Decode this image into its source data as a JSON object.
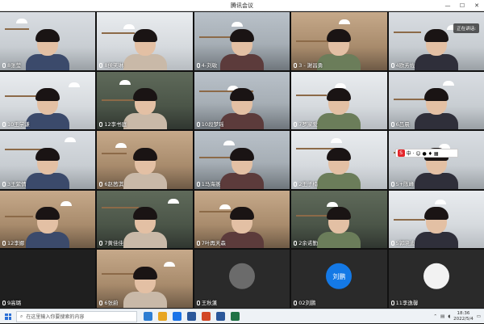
{
  "window": {
    "title": "腾讯会议",
    "minimize": "—",
    "maximize": "☐",
    "close": "✕"
  },
  "speaking": "正在讲话:",
  "ime": {
    "logo": "S",
    "items": "中 · ☺ ● ♦ ▦"
  },
  "tiles": [
    {
      "name": "8张莹",
      "type": "cam",
      "wall": "wall-a"
    },
    {
      "name": "8侯笑琳",
      "type": "cam",
      "wall": "wall-c"
    },
    {
      "name": "4-刘敏",
      "type": "cam",
      "wall": "wall-b"
    },
    {
      "name": "3 - 謝昌勇",
      "type": "cam",
      "wall": "wall-e"
    },
    {
      "name": "4欧芳佐",
      "type": "cam",
      "wall": "wall-a"
    },
    {
      "name": "10王学谦",
      "type": "cam",
      "wall": "wall-c"
    },
    {
      "name": "12李书庭",
      "type": "cam",
      "wall": "wall-d"
    },
    {
      "name": "10段梦瑶",
      "type": "cam",
      "wall": "wall-b"
    },
    {
      "name": "7罗家爱",
      "type": "cam",
      "wall": "wall-c"
    },
    {
      "name": "6吕晨",
      "type": "cam",
      "wall": "wall-a"
    },
    {
      "name": "3王紫情",
      "type": "cam",
      "wall": "wall-a"
    },
    {
      "name": "6赵茜淇",
      "type": "cam",
      "wall": "wall-e"
    },
    {
      "name": "1马海蒸",
      "type": "cam",
      "wall": "wall-b"
    },
    {
      "name": "2王子楠",
      "type": "cam",
      "wall": "wall-c"
    },
    {
      "name": "5+陈峰",
      "type": "cam",
      "wall": "wall-a"
    },
    {
      "name": "12李娜",
      "type": "cam",
      "wall": "wall-e"
    },
    {
      "name": "7黄佳佳",
      "type": "cam",
      "wall": "wall-d"
    },
    {
      "name": "7叶再天森",
      "type": "cam",
      "wall": "wall-e"
    },
    {
      "name": "2余诺勤",
      "type": "cam",
      "wall": "wall-d"
    },
    {
      "name": "5郭晓迪",
      "type": "cam",
      "wall": "wall-c"
    },
    {
      "name": "9高璐",
      "type": "dark"
    },
    {
      "name": "6张蔚",
      "type": "cam",
      "wall": "wall-e"
    },
    {
      "name": "王秋蓬",
      "type": "avatar",
      "label": ""
    },
    {
      "name": "02刘鹏",
      "type": "avatar",
      "label": "刘鹏"
    },
    {
      "name": "11李逸馨",
      "type": "avatar",
      "label": ""
    }
  ],
  "taskbar": {
    "search_placeholder": "在这里输入你要搜索的内容",
    "icons": [
      "#2d7dd2",
      "#e8a521",
      "#1a73e8",
      "#2b579a",
      "#d24726",
      "#2b579a",
      "#217346"
    ],
    "time": "18:36",
    "date": "2022/5/4"
  }
}
